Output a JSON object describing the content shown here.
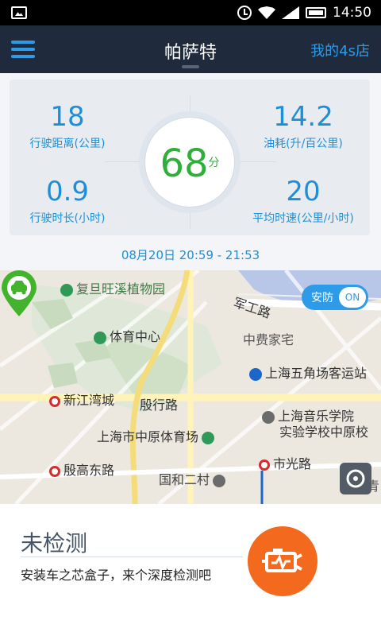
{
  "status_bar": {
    "time": "14:50",
    "icons": [
      "image-icon",
      "alarm-icon",
      "wifi-icon",
      "signal-icon",
      "battery-icon"
    ]
  },
  "header": {
    "title": "帕萨特",
    "right_link": "我的4s店",
    "menu_icon": "menu-icon"
  },
  "stats": {
    "distance": {
      "value": "18",
      "label": "行驶距离(公里)"
    },
    "fuel": {
      "value": "14.2",
      "label": "油耗(升/百公里)"
    },
    "duration": {
      "value": "0.9",
      "label": "行驶时长(小时)"
    },
    "speed": {
      "value": "20",
      "label": "平均时速(公里/小时)"
    },
    "score": {
      "value": "68",
      "unit": "分"
    },
    "timerange": "08月20日 20:59 - 21:53"
  },
  "map": {
    "toggle_label": "安防",
    "toggle_state": "ON",
    "labels": {
      "garden": "复旦旺溪植物园",
      "jungong": "军工路",
      "sports_center": "体育中心",
      "zhongfei": "中费家宅",
      "bus_station": "上海五角场客运站",
      "xinjiangwan": "新江湾城",
      "yinxing_road": "殷行路",
      "music_school_1": "上海音乐学院",
      "music_school_2": "实验学校中原校",
      "zhongyuan_stadium": "上海市中原体育场",
      "yingao_road": "殷高东路",
      "shiguang_road": "市光路",
      "guohe": "国和二村",
      "corner": "共青"
    }
  },
  "bottom": {
    "title": "未检测",
    "subtitle": "安装车之芯盒子，来个深度检测吧"
  },
  "colors": {
    "accent": "#2e9be8",
    "header_bg": "#1f2a3c",
    "score_green": "#2fae3a",
    "orange": "#f36a1e"
  }
}
